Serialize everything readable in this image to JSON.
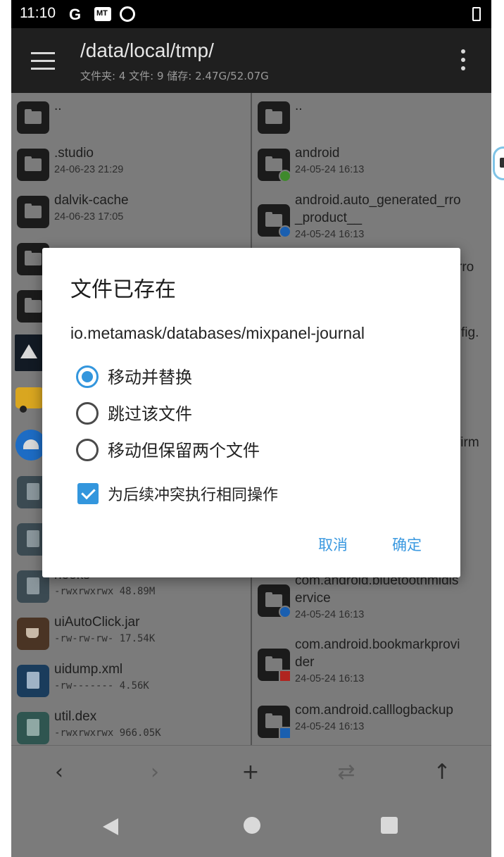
{
  "status_bar": {
    "time": "11:10",
    "icons": [
      "google-icon",
      "mt-icon",
      "vpn-icon",
      "battery-charging-icon"
    ],
    "google_letter": "G",
    "mt_label": "MT"
  },
  "app_bar": {
    "title": "/data/local/tmp/",
    "subtitle": "文件夹: 4  文件: 9  储存: 2.47G/52.07G"
  },
  "left_pane": {
    "items": [
      {
        "name": "..",
        "meta": ""
      },
      {
        "name": ".studio",
        "meta": "24-06-23 21:29"
      },
      {
        "name": "dalvik-cache",
        "meta": "24-06-23 17:05"
      },
      {
        "name": "hooks",
        "meta": "-rwxrwxrwx  48.89M"
      },
      {
        "name": "uiAutoClick.jar",
        "meta": "-rw-rw-rw-  17.54K"
      },
      {
        "name": "uidump.xml",
        "meta": "-rw-------  4.56K"
      },
      {
        "name": "util.dex",
        "meta": "-rwxrwxrwx  966.05K"
      }
    ]
  },
  "right_pane": {
    "items": [
      {
        "name": "..",
        "meta": ""
      },
      {
        "name": "android",
        "meta": "24-05-24 16:13"
      },
      {
        "name_line1": "android.auto_generated_rro",
        "name_line2": "_product__",
        "meta": "24-05-24 16:13"
      },
      {
        "name_line1": "com.android.bluetoothmidis",
        "name_line2": "ervice",
        "meta": "24-05-24 16:13"
      },
      {
        "name_line1": "com.android.bookmarkprovi",
        "name_line2": "der",
        "meta": "24-05-24 16:13"
      },
      {
        "name": "com.android.calllogbackup",
        "meta": "24-05-24 16:13"
      }
    ],
    "partial": [
      "rro",
      "fig.",
      "firm"
    ]
  },
  "dialog": {
    "title": "文件已存在",
    "path": "io.metamask/databases/mixpanel-journal",
    "options": [
      {
        "label": "移动并替换",
        "selected": true
      },
      {
        "label": "跳过该文件",
        "selected": false
      },
      {
        "label": "移动但保留两个文件",
        "selected": false
      }
    ],
    "apply_all": {
      "label": "为后续冲突执行相同操作",
      "checked": true
    },
    "cancel_label": "取消",
    "ok_label": "确定",
    "accent_color": "#3396dd"
  },
  "bottom_bar": {
    "back": "‹",
    "forward": "›",
    "add": "+",
    "swap": "⇄",
    "up": "↑"
  }
}
